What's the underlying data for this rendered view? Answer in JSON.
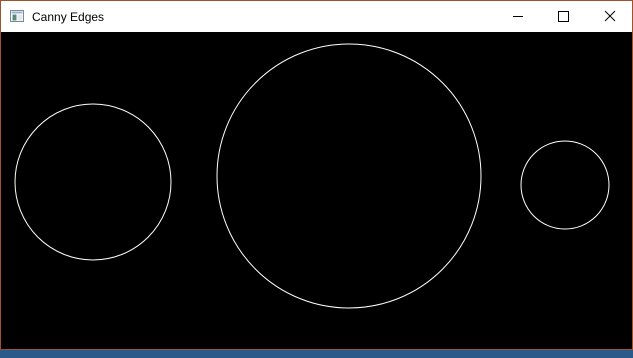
{
  "window": {
    "title": "Canny Edges",
    "app_icon": "window-app-icon",
    "controls": {
      "minimize": "minimize-icon",
      "maximize": "maximize-icon",
      "close": "close-icon"
    }
  },
  "image": {
    "background_color": "#000000",
    "edge_color": "#ffffff",
    "edge_count": 3,
    "edges": [
      "circle-edge",
      "circle-edge",
      "circle-edge"
    ]
  }
}
